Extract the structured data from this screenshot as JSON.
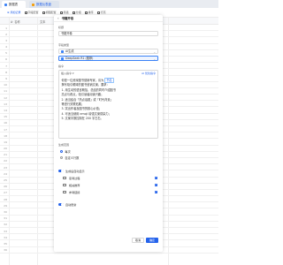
{
  "tabs": [
    {
      "label": "数据表"
    },
    {
      "label": "数据仪表盘"
    }
  ],
  "toolbar": {
    "items": [
      {
        "label": "添加记录",
        "icon": "plus-icon",
        "primary": true
      },
      {
        "label": "字段配置",
        "icon": "gear-icon"
      },
      {
        "label": "视图配置",
        "icon": "layout-icon"
      },
      {
        "label": "筛选",
        "icon": "filter-icon"
      },
      {
        "label": "分组",
        "icon": "group-icon"
      },
      {
        "label": "排序",
        "icon": "sort-icon"
      },
      {
        "label": "行高",
        "icon": "row-height-icon"
      }
    ]
  },
  "grid": {
    "columns": [
      "A· 名称",
      "文本"
    ],
    "row_numbers": [
      "1",
      "2",
      "3",
      "4",
      "5",
      "6",
      "7",
      "8",
      "9",
      "10",
      "11",
      "12",
      "13",
      "14",
      "15",
      "16",
      "17",
      "18",
      "19",
      "20",
      "21",
      "22",
      "23",
      "24",
      "25",
      "26",
      "27",
      "28",
      "29",
      "30",
      "31",
      "32",
      "33",
      "34",
      "35",
      "36"
    ]
  },
  "panel": {
    "title": "书籍开卷",
    "name_label": "标题",
    "name_value": "书籍开卷",
    "mode_label": "字段类型",
    "field_type": "AI生成",
    "model_value": "DeepSeek R1 (推荐)",
    "prompt_label": "指令",
    "prompt_insert": "插入指令 ▾",
    "prompt_ai": "AI 优化指令",
    "prompt_lines": [
      "你是一位资深图书营销专家，请为",
      "撰写吸引眼球的图书营销文案，要求：",
      "1. 用生动的语言概括，总结的同时介绍图书",
      "亮点与看点，吸引读者阅读兴趣；",
      "2. 适当结合「热点话题」或「时代背景」",
      "等进行关联拓展；",
      "3. 突出作者及图书的核心价值；",
      "4. 可适当使用 emoji 增强文案感染力；",
      "5. 文案字数控制在 200 字左右。"
    ],
    "prompt_mention": "书名",
    "output_label": "生成范围",
    "output_options": [
      {
        "label": "每次",
        "selected": true
      },
      {
        "label": "自定义行数",
        "selected": false
      }
    ],
    "toggle_label": "生成后自动显示",
    "checkboxes": [
      {
        "label": "思考过程",
        "checked": true
      },
      {
        "label": "相关推荐",
        "checked": true
      },
      {
        "label": "参考链接",
        "checked": true
      }
    ],
    "auto_update_label": "自动更新",
    "cancel_label": "取消",
    "ok_label": "确定"
  },
  "colors": {
    "accent": "#2563eb",
    "tabbar": "#e9ecf1"
  }
}
